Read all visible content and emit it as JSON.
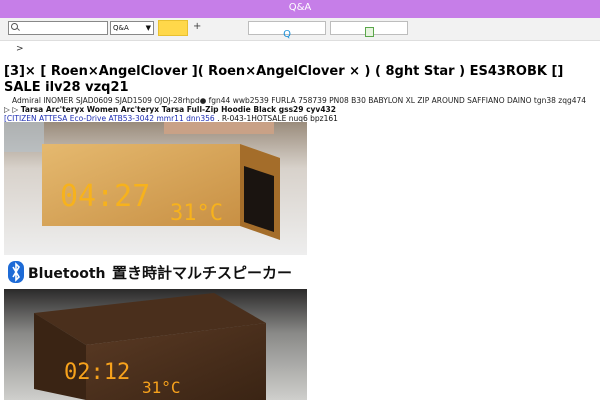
{
  "header": {
    "title": "Q&A"
  },
  "toolbar": {
    "search": {
      "value": "",
      "placeholder": ""
    },
    "select": {
      "value": "Q&A"
    },
    "plus": "+",
    "q_label": "Q"
  },
  "breadcrumb": {
    "separator": ">"
  },
  "page": {
    "headline": "[3]× [ Roen×AngelClover ]( Roen×AngelClover × ) ( 8ght Star ) ES43ROBK [] SALE ilv28 vzq21",
    "line1": "Admiral INOMER SJAD0609 SJAD1509 OJOJ-28rhpd● fgn44 wwb2539 FURLA 758739 PN08 B30 BABYLON XL ZIP AROUND SAFFIANO DAINO tgn38 zqg474",
    "line2_prefix": "▷ ▷",
    "line2_tarsa": "Tarsa",
    "line2_rest": "Arc'teryx Women Arc'teryx Tarsa Full-Zip Hoodie Black gss29 cyv432",
    "line3_links": [
      "[CITIZEN ATTESA Eco-Drive",
      "ATB53-3042",
      "mmr11 dnn356"
    ],
    "line3_tail": ". R-043-1HOTSALE nuq6 bpz161"
  },
  "product": {
    "clock1": {
      "time": "04:27",
      "temp": "31°C"
    },
    "banner": {
      "brand": "Bluetooth",
      "caption": "置き時計マルチスピーカー"
    },
    "clock2": {
      "time": "02:12",
      "temp": "31°C"
    }
  },
  "colors": {
    "topbar": "#c67ee8",
    "led": "#f7b21c",
    "link": "#1f2fb3"
  }
}
